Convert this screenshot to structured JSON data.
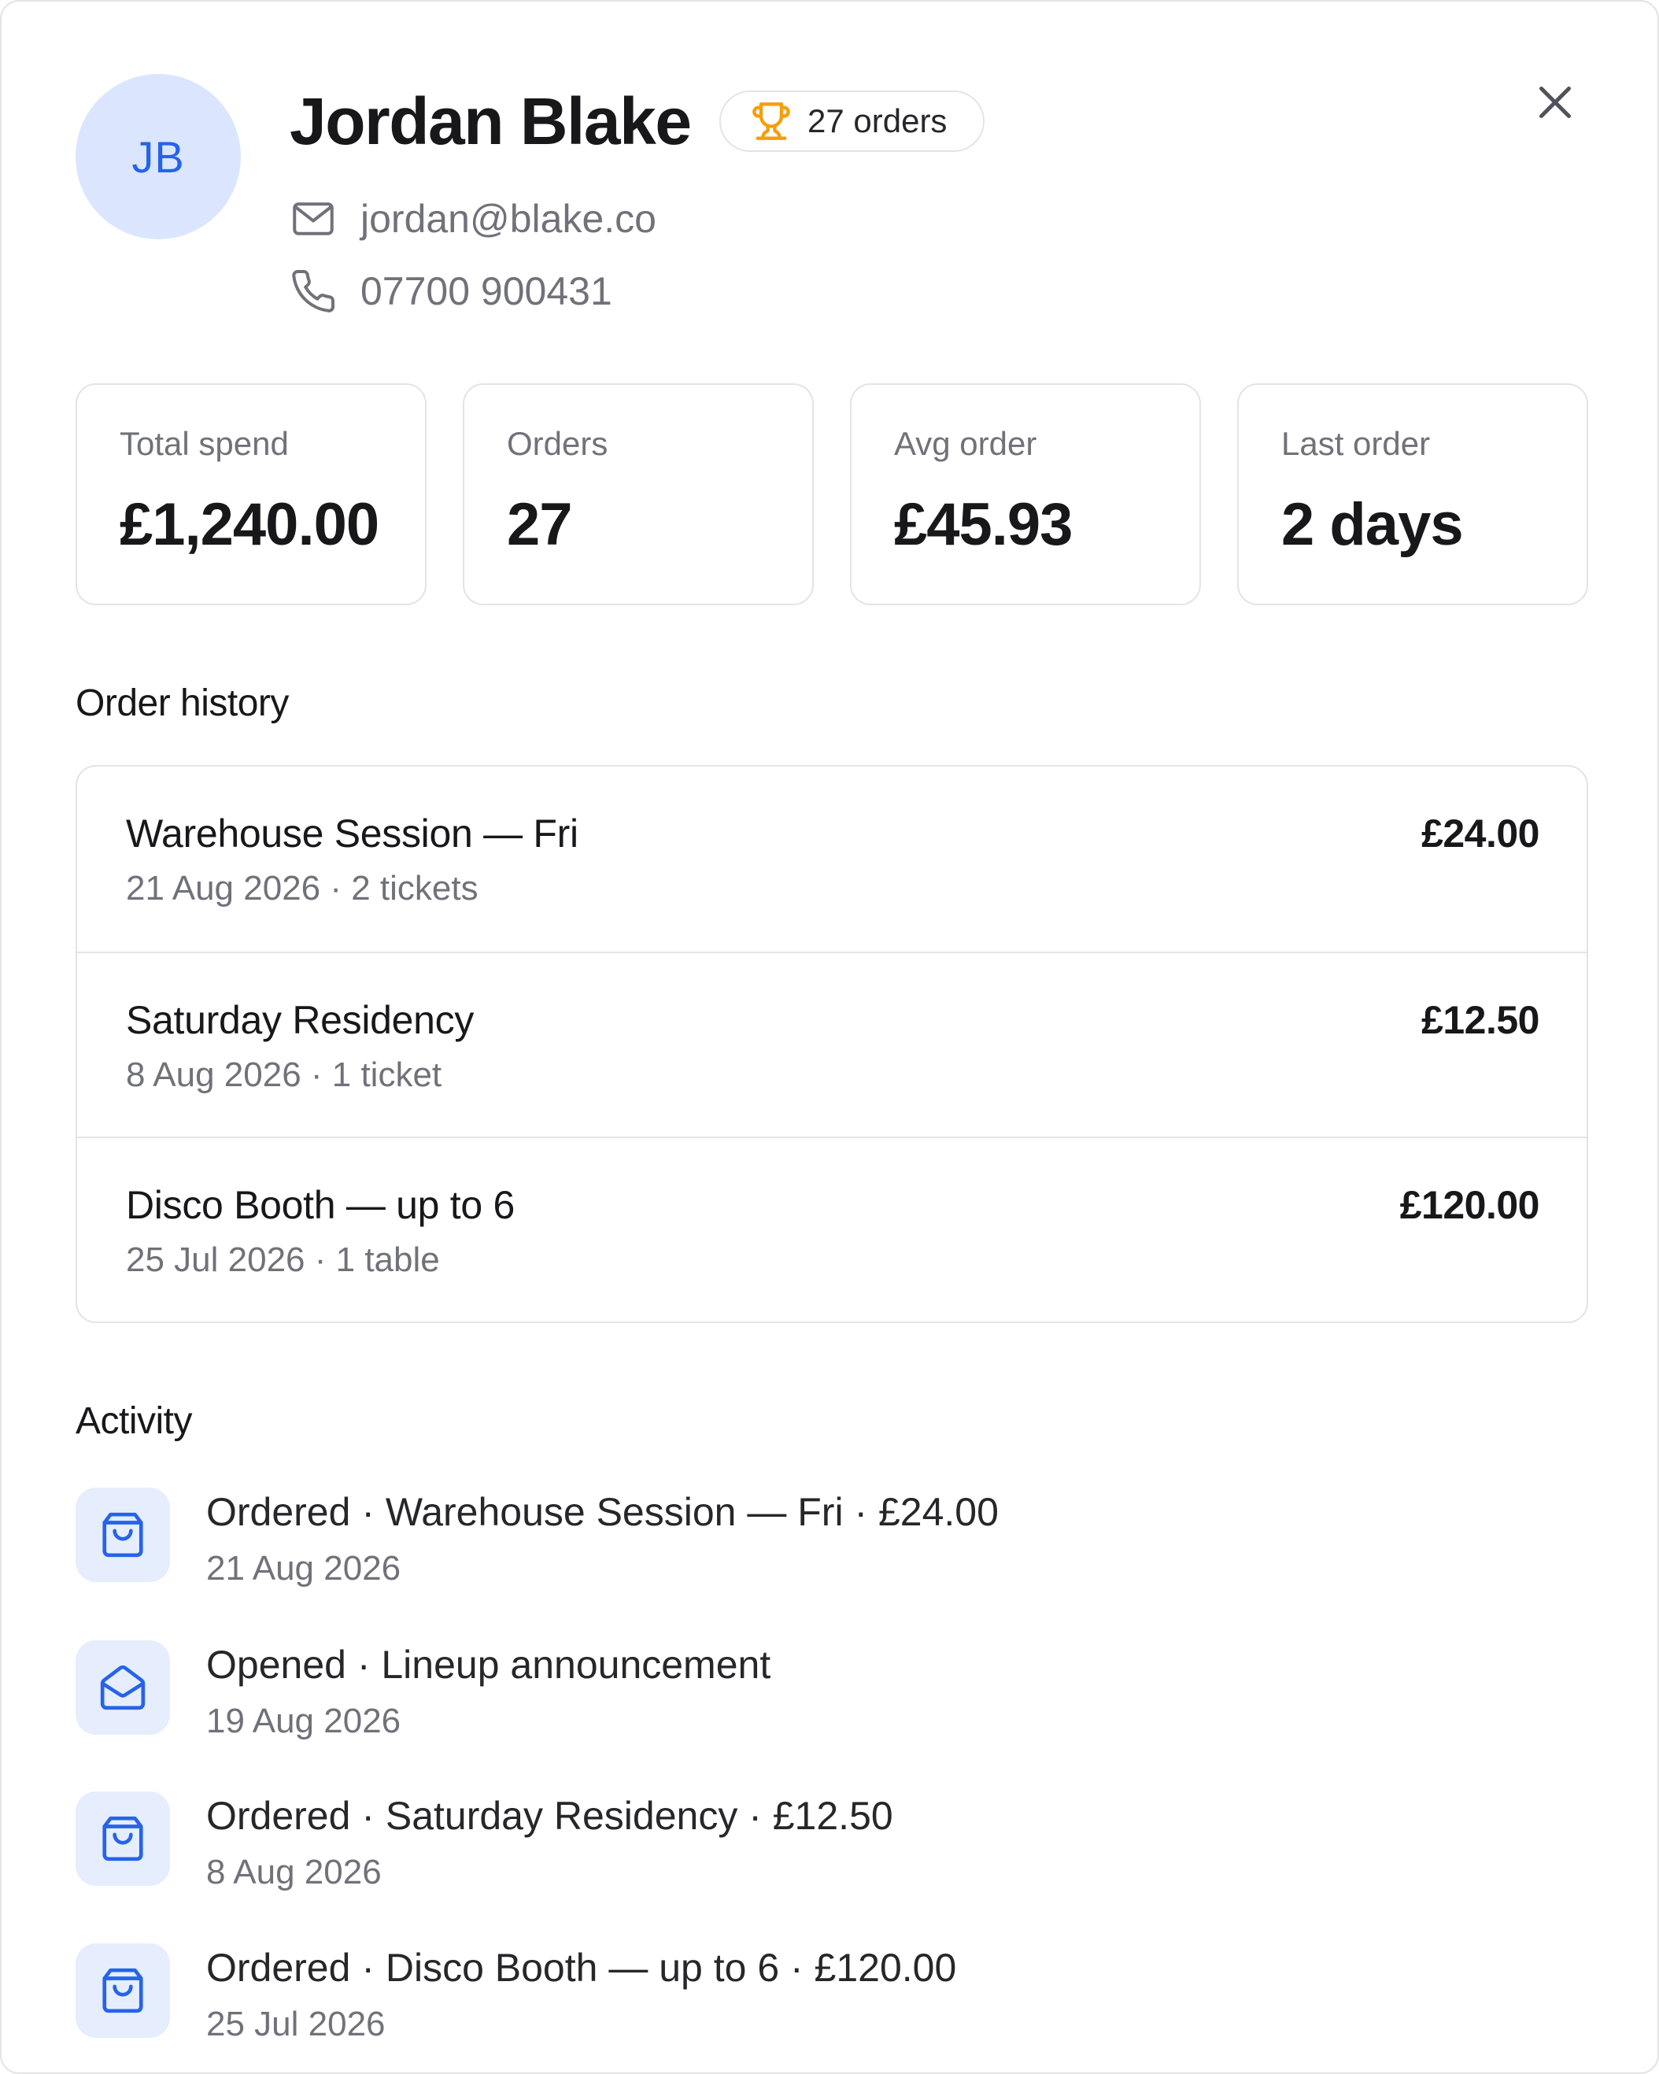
{
  "customer": {
    "initials": "JB",
    "name": "Jordan Blake",
    "orders_badge": "27 orders",
    "email": "jordan@blake.co",
    "phone": "07700 900431"
  },
  "stats": [
    {
      "label": "Total spend",
      "value": "£1,240.00"
    },
    {
      "label": "Orders",
      "value": "27"
    },
    {
      "label": "Avg order",
      "value": "£45.93"
    },
    {
      "label": "Last order",
      "value": "2 days"
    }
  ],
  "order_history": {
    "title": "Order history",
    "orders": [
      {
        "title": "Warehouse Session — Fri",
        "meta": "21 Aug 2026 · 2 tickets",
        "price": "£24.00"
      },
      {
        "title": "Saturday Residency",
        "meta": "8 Aug 2026 · 1 ticket",
        "price": "£12.50"
      },
      {
        "title": "Disco Booth — up to 6",
        "meta": "25 Jul 2026 · 1 table",
        "price": "£120.00"
      }
    ]
  },
  "activity": {
    "title": "Activity",
    "items": [
      {
        "icon": "shopping-bag-icon",
        "text": "Ordered · Warehouse Session — Fri · £24.00",
        "date": "21 Aug 2026"
      },
      {
        "icon": "mail-open-icon",
        "text": "Opened · Lineup announcement",
        "date": "19 Aug 2026"
      },
      {
        "icon": "shopping-bag-icon",
        "text": "Ordered · Saturday Residency · £12.50",
        "date": "8 Aug 2026"
      },
      {
        "icon": "shopping-bag-icon",
        "text": "Ordered · Disco Booth — up to 6 · £120.00",
        "date": "25 Jul 2026"
      }
    ]
  },
  "colors": {
    "accent": "#2563eb",
    "avatar_bg": "#dbe6fe",
    "trophy": "#f59e0b",
    "muted_text": "#71717a",
    "border": "#e4e4e7"
  }
}
